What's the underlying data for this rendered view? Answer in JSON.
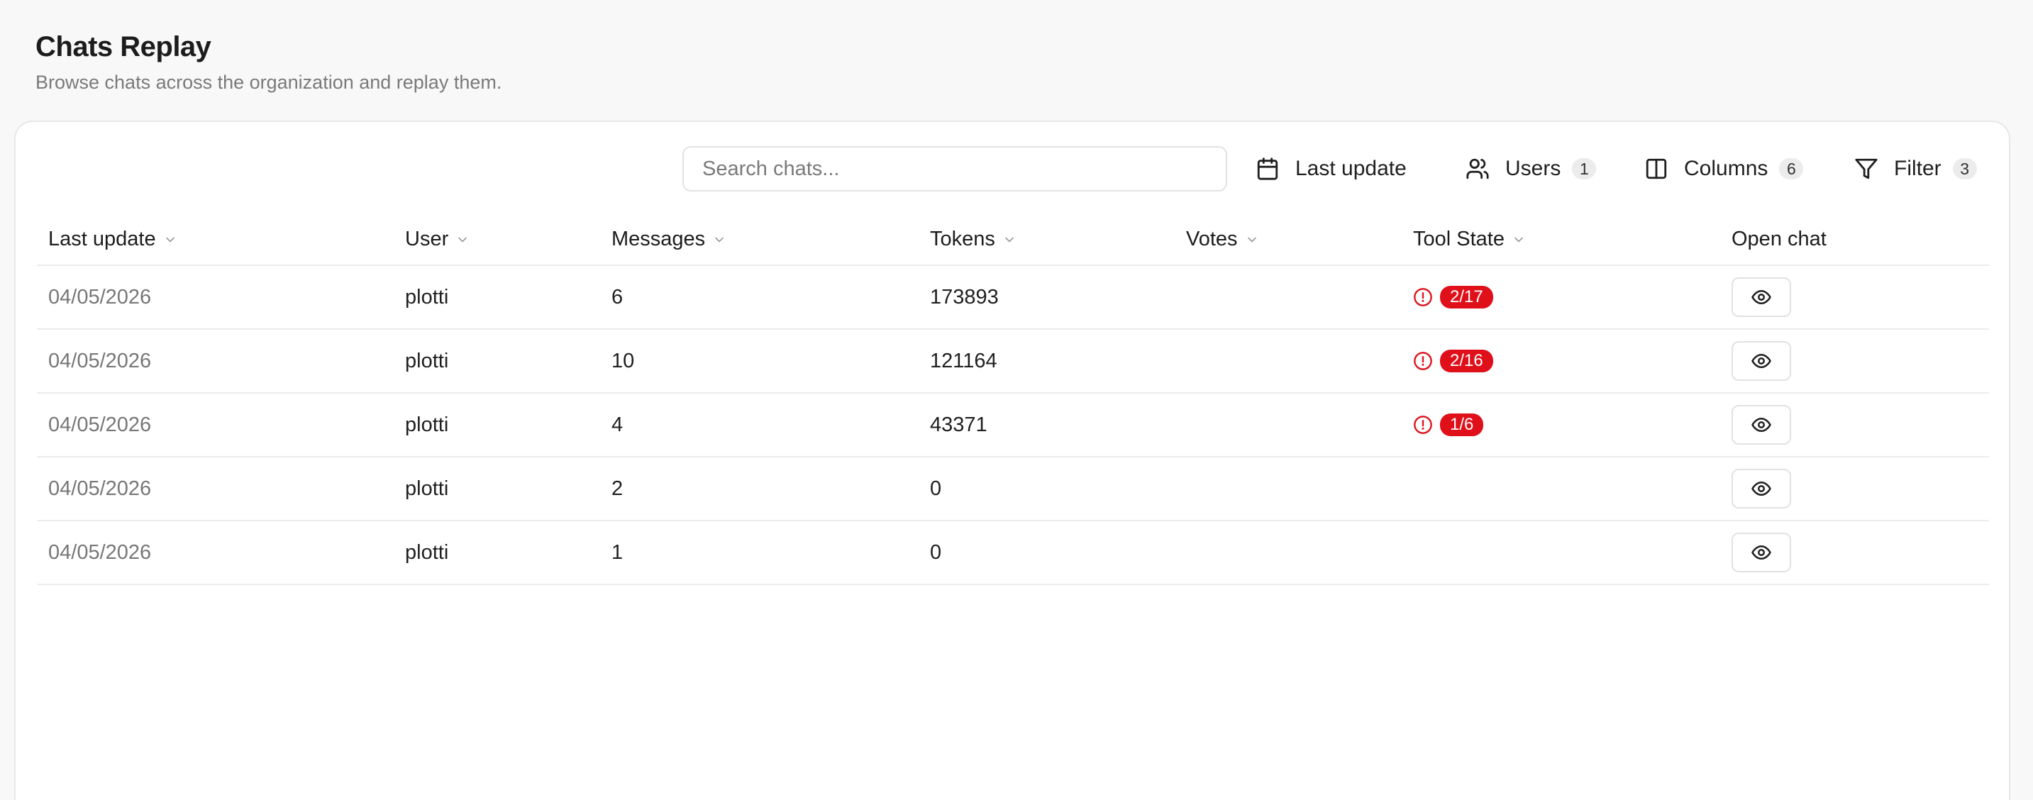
{
  "page": {
    "title": "Chats Replay",
    "subtitle": "Browse chats across the organization and replay them."
  },
  "toolbar": {
    "search_placeholder": "Search chats...",
    "last_update_label": "Last update",
    "users_label": "Users",
    "users_count": "1",
    "columns_label": "Columns",
    "columns_count": "6",
    "filter_label": "Filter",
    "filter_count": "3"
  },
  "table": {
    "columns": [
      {
        "key": "last_update",
        "label": "Last update",
        "sortable": true
      },
      {
        "key": "user",
        "label": "User",
        "sortable": true
      },
      {
        "key": "messages",
        "label": "Messages",
        "sortable": true
      },
      {
        "key": "tokens",
        "label": "Tokens",
        "sortable": true
      },
      {
        "key": "votes",
        "label": "Votes",
        "sortable": true
      },
      {
        "key": "tool_state",
        "label": "Tool State",
        "sortable": true
      },
      {
        "key": "open_chat",
        "label": "Open chat",
        "sortable": false
      }
    ],
    "rows": [
      {
        "last_update": "04/05/2026",
        "user": "plotti",
        "messages": "6",
        "tokens": "173893",
        "votes": "",
        "tool_state": "2/17"
      },
      {
        "last_update": "04/05/2026",
        "user": "plotti",
        "messages": "10",
        "tokens": "121164",
        "votes": "",
        "tool_state": "2/16"
      },
      {
        "last_update": "04/05/2026",
        "user": "plotti",
        "messages": "4",
        "tokens": "43371",
        "votes": "",
        "tool_state": "1/6"
      },
      {
        "last_update": "04/05/2026",
        "user": "plotti",
        "messages": "2",
        "tokens": "0",
        "votes": "",
        "tool_state": ""
      },
      {
        "last_update": "04/05/2026",
        "user": "plotti",
        "messages": "1",
        "tokens": "0",
        "votes": "",
        "tool_state": ""
      }
    ]
  },
  "icons": {
    "last_update": "calendar-icon",
    "users": "users-icon",
    "columns": "columns-icon",
    "filter": "filter-icon",
    "sort": "chevron-down-icon",
    "tool_state_alert": "alert-circle-icon",
    "open_chat": "eye-icon"
  },
  "colors": {
    "background": "#f8f8f8",
    "card": "#ffffff",
    "error_badge": "#e0101a",
    "muted_text": "#7a7a7a"
  }
}
